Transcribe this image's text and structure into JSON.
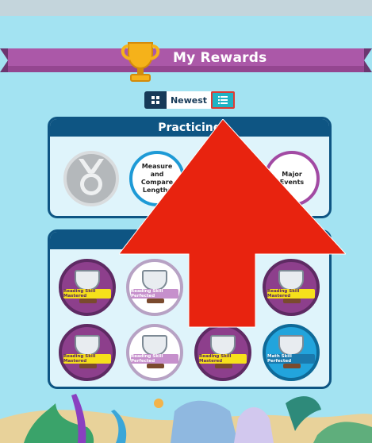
{
  "header": {
    "title": "My Rewards",
    "icon": "trophy-icon"
  },
  "toolbar": {
    "grid_icon": "grid-icon",
    "sort_label": "Newest",
    "list_icon": "list-icon"
  },
  "practicing": {
    "heading": "Practicing",
    "badges": [
      {
        "label": "",
        "style": "gray-medal"
      },
      {
        "label": "Measure and Compare Lengths",
        "style": "white-blue-ring"
      },
      {
        "label": "Major Events",
        "style": "white-purple-ring"
      }
    ]
  },
  "rewards": {
    "heading": "",
    "items": [
      {
        "banner": "Reading Skill Mastered",
        "style": "purple"
      },
      {
        "banner": "Reading Skill Perfected",
        "style": "white"
      },
      {
        "banner": "",
        "style": "hidden"
      },
      {
        "banner": "Reading Skill Mastered",
        "style": "purple"
      },
      {
        "banner": "Reading Skill Mastered",
        "style": "purple"
      },
      {
        "banner": "Reading Skill Perfected",
        "style": "white"
      },
      {
        "banner": "Reading Skill Mastered",
        "style": "purple"
      },
      {
        "banner": "Math Skill Perfected",
        "style": "blue"
      }
    ]
  },
  "overlay": {
    "arrow": "up-arrow",
    "arrow_color": "#e8230f"
  },
  "colors": {
    "background": "#a3e3f2",
    "panel_header": "#0e5583",
    "ribbon": "#ab58a8"
  }
}
